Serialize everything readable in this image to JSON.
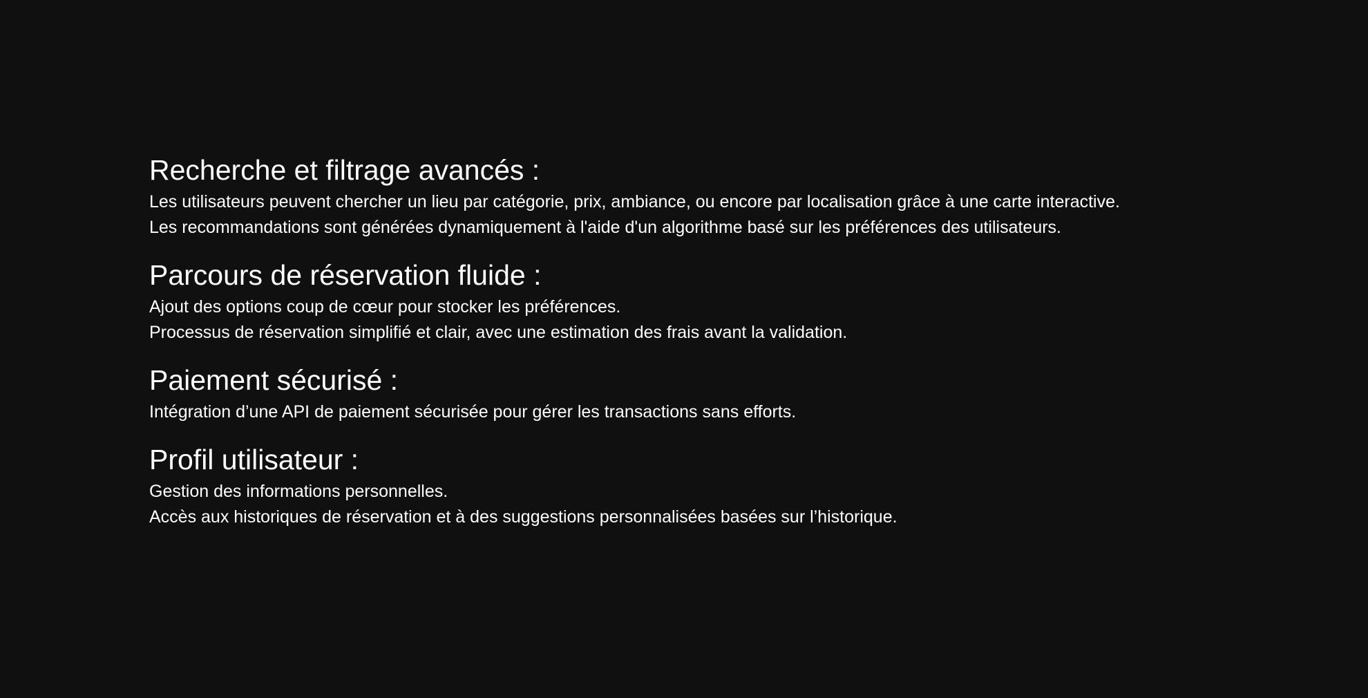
{
  "sections": [
    {
      "heading": "Recherche et filtrage avancés :",
      "lines": [
        "Les utilisateurs peuvent chercher un lieu par catégorie, prix, ambiance, ou encore par localisation grâce à une carte interactive.",
        "Les recommandations sont générées dynamiquement à l'aide d'un algorithme basé sur les préférences des utilisateurs."
      ]
    },
    {
      "heading": "Parcours de réservation fluide :",
      "lines": [
        "Ajout des options coup de cœur pour stocker les préférences.",
        "Processus de réservation simplifié et clair, avec une estimation des frais avant la validation."
      ]
    },
    {
      "heading": "Paiement sécurisé :",
      "lines": [
        "Intégration d’une API de paiement sécurisée pour gérer les transactions sans efforts."
      ]
    },
    {
      "heading": "Profil utilisateur :",
      "lines": [
        "Gestion des informations personnelles.",
        "Accès aux historiques de réservation et à des suggestions personnalisées basées sur l’historique."
      ]
    }
  ]
}
